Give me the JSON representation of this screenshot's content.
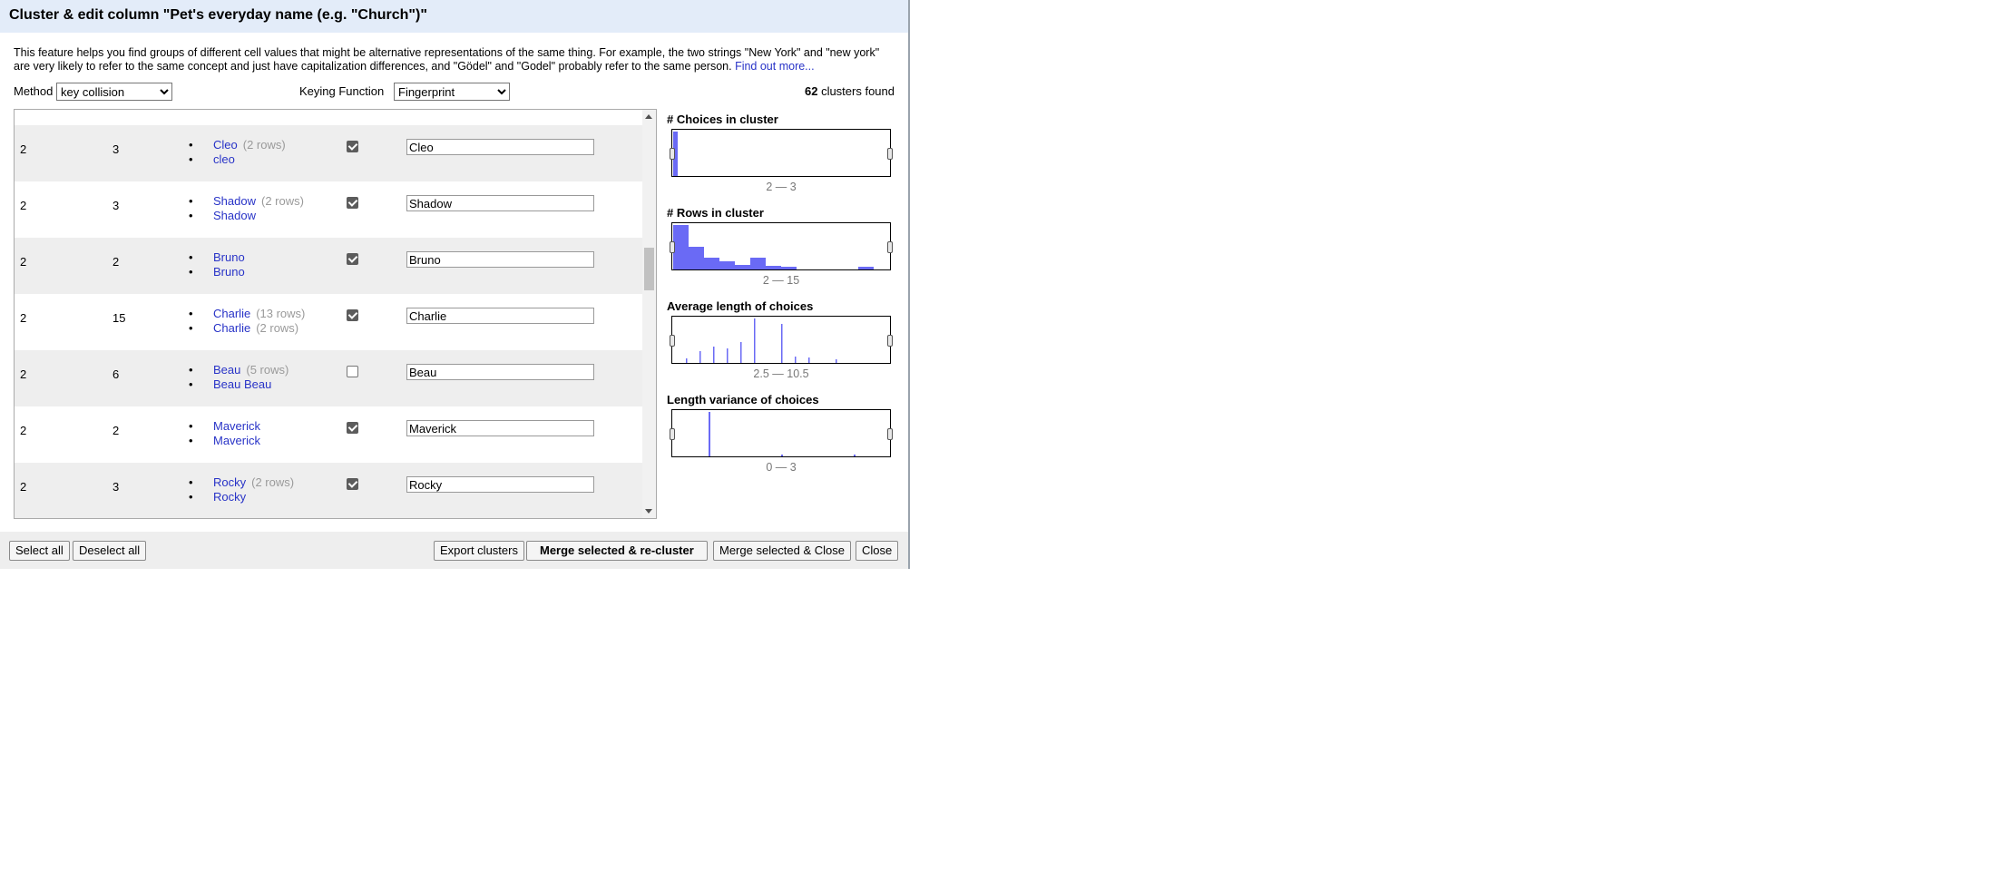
{
  "dialog": {
    "title": "Cluster & edit column \"Pet's everyday name (e.g. \"Church\")\"",
    "description": "This feature helps you find groups of different cell values that might be alternative representations of the same thing. For example, the two strings \"New York\" and \"new york\" are very likely to refer to the same concept and just have capitalization differences, and \"Gödel\" and \"Godel\" probably refer to the same person.",
    "find_out_more": "Find out more..."
  },
  "controls": {
    "method_label": "Method",
    "method_value": "key collision",
    "keying_label": "Keying Function",
    "keying_value": "Fingerprint",
    "clusters_count": "62",
    "clusters_found_text": "clusters found"
  },
  "clusters": [
    {
      "size": "2",
      "rows": "3",
      "values": [
        {
          "text": "Cleo",
          "count": "(2 rows)"
        },
        {
          "text": "cleo",
          "count": ""
        }
      ],
      "merge": true,
      "new_value": "Cleo"
    },
    {
      "size": "2",
      "rows": "3",
      "values": [
        {
          "text": "Shadow",
          "count": "(2 rows)"
        },
        {
          "text": "Shadow",
          "count": ""
        }
      ],
      "merge": true,
      "new_value": "Shadow"
    },
    {
      "size": "2",
      "rows": "2",
      "values": [
        {
          "text": "Bruno",
          "count": ""
        },
        {
          "text": "Bruno",
          "count": ""
        }
      ],
      "merge": true,
      "new_value": "Bruno"
    },
    {
      "size": "2",
      "rows": "15",
      "values": [
        {
          "text": "Charlie",
          "count": "(13 rows)"
        },
        {
          "text": "Charlie",
          "count": "(2 rows)"
        }
      ],
      "merge": true,
      "new_value": "Charlie"
    },
    {
      "size": "2",
      "rows": "6",
      "values": [
        {
          "text": "Beau",
          "count": "(5 rows)"
        },
        {
          "text": "Beau Beau",
          "count": ""
        }
      ],
      "merge": false,
      "new_value": "Beau"
    },
    {
      "size": "2",
      "rows": "2",
      "values": [
        {
          "text": "Maverick",
          "count": ""
        },
        {
          "text": "Maverick",
          "count": ""
        }
      ],
      "merge": true,
      "new_value": "Maverick"
    },
    {
      "size": "2",
      "rows": "3",
      "values": [
        {
          "text": "Rocky",
          "count": "(2 rows)"
        },
        {
          "text": "Rocky",
          "count": ""
        }
      ],
      "merge": true,
      "new_value": "Rocky"
    }
  ],
  "facets": {
    "choices": {
      "title": "# Choices in cluster",
      "range": "2 — 3"
    },
    "rows": {
      "title": "# Rows in cluster",
      "range": "2 — 15"
    },
    "avg_length": {
      "title": "Average length of choices",
      "range": "2.5 — 10.5"
    },
    "variance": {
      "title": "Length variance of choices",
      "range": "0 — 3"
    }
  },
  "buttons": {
    "select_all": "Select all",
    "deselect_all": "Deselect all",
    "export": "Export clusters",
    "merge_recluster": "Merge selected & re-cluster",
    "merge_close": "Merge selected & Close",
    "close": "Close"
  },
  "colors": {
    "histogram": "#6a6af5",
    "link": "#2833c7",
    "title_bar": "#e3ecf9"
  }
}
